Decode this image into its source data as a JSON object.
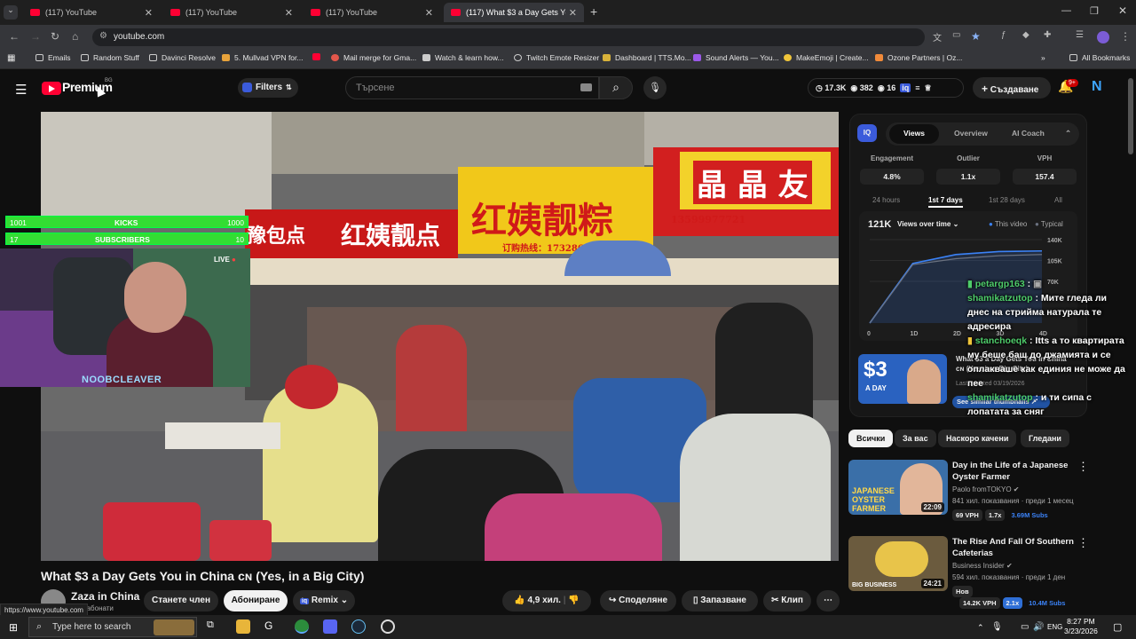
{
  "browser": {
    "tabs": [
      {
        "title": "(117) YouTube"
      },
      {
        "title": "(117) YouTube"
      },
      {
        "title": "(117) YouTube"
      },
      {
        "title": "(117) What $3 a Day Gets You in China"
      }
    ],
    "url": "youtube.com",
    "bookmarks": [
      "Emails",
      "Random Stuff",
      "Davinci Resolve",
      "5. Mullvad VPN for...",
      "Mail merge for Gma...",
      "Watch & learn how...",
      "Twitch Emote Resizer",
      "Dashboard | TTS.Mo...",
      "Sound Alerts — You...",
      "MakeEmoji | Create...",
      "Ozone Partners | Oz..."
    ],
    "all_bookmarks": "All Bookmarks",
    "status_url": "https://www.youtube.com"
  },
  "header": {
    "logo_text": "Premium",
    "logo_region": "BG",
    "filters_label": "Filters",
    "search_placeholder": "Търсене",
    "stats": {
      "views": "17.3K",
      "watching": "382",
      "count": "16"
    },
    "create_label": "Създаване",
    "notifications": "9+",
    "avatar_letter": "N"
  },
  "overlay": {
    "kicks_left": "1001",
    "kicks_label": "KICKS",
    "kicks_right": "1000",
    "subs_left": "17",
    "subs_label": "SUBSCRIBERS",
    "subs_right": "10",
    "kicks_progress": 1.0,
    "subs_progress": 1.0,
    "live_label": "LIVE",
    "streamer_name": "NOOBCLEAVER"
  },
  "video": {
    "signs": [
      "红姨靓粽",
      "晶 晶 友",
      "红姨靓点",
      "豫包点"
    ],
    "sign_phone": "订购热线：17328617438",
    "sign_phone2": "13599977721",
    "title": "What $3 a Day Gets You in China ᴄɴ (Yes, in a Big City)",
    "channel": "Zaza in China",
    "subscribers": "хил. абонати",
    "join_label": "Станете член",
    "subscribe_label": "Абониране",
    "remix_label": "Remix",
    "likes": "4,9 хил.",
    "share_label": "Споделяне",
    "save_label": "Запазване",
    "clip_label": "Клип"
  },
  "panel": {
    "tabs": [
      "Views",
      "Overview",
      "AI Coach"
    ],
    "metrics": [
      {
        "label": "Engagement",
        "value": "4.8%"
      },
      {
        "label": "Outlier",
        "value": "1.1x"
      },
      {
        "label": "VPH",
        "value": "157.4"
      }
    ],
    "ranges": [
      "24 hours",
      "1st 7 days",
      "1st 28 days",
      "All"
    ],
    "total_views": "121K",
    "chart_mode": "Views over time",
    "legend_this": "This video",
    "legend_typical": "Typical",
    "thumb_price": "$3",
    "thumb_sub": "A DAY",
    "thumb_title": "What $3 a Day Gets You in China ᴄɴ (Yes, in a Big City)",
    "last_updated": "Last updated 03/19/2026",
    "similar_label": "See similar thumbnails"
  },
  "chart_data": {
    "type": "line",
    "x": [
      "0",
      "1D",
      "2D",
      "3D",
      "4D"
    ],
    "series": [
      {
        "name": "This video",
        "values": [
          0,
          100,
          115,
          120,
          121
        ]
      },
      {
        "name": "Typical",
        "values": [
          0,
          98,
          108,
          113,
          115
        ]
      }
    ],
    "ytick_labels": [
      "140K",
      "105K",
      "70K"
    ],
    "ylim": [
      0,
      140
    ],
    "colors": {
      "this": "#3b82f6",
      "typical": "#6b7280"
    }
  },
  "chat": [
    {
      "user": "petargp163",
      "msg": ""
    },
    {
      "user": "shamikatzutop",
      "msg": "Мите гледа ли днес на стрийма натурала те адресира"
    },
    {
      "user": "stanchoeqk",
      "msg": "Itts а то квартирата му беше баш до джамията и се оплакваше как единия не може да пее"
    },
    {
      "user": "shamikatzutop",
      "msg": "и ти сипа с лопатата за сняг"
    }
  ],
  "chips": [
    "Всички",
    "За вас",
    "Наскоро качени",
    "Гледани"
  ],
  "related": [
    {
      "title": "Day in the Life of a Japanese Oyster Farmer",
      "channel": "Paolo fromTOKYO",
      "meta": "841 хил. показвания · преди 1 месец",
      "duration": "22:09",
      "thumb_text": "JAPANESE OYSTER FARMER",
      "badges": [
        "69 VPH",
        "1.7x",
        "3.69M Subs"
      ]
    },
    {
      "title": "The Rise And Fall Of Southern Cafeterias",
      "channel": "Business Insider",
      "meta": "594 хил. показвания · преди 1 ден",
      "tag": "Нов",
      "duration": "24:21",
      "thumb_text": "BIG BUSINESS",
      "badges": [
        "14.2K VPH",
        "2.1x",
        "10.4M Subs"
      ]
    }
  ],
  "taskbar": {
    "search_placeholder": "Type here to search",
    "lang": "ENG",
    "time": "8:27 PM",
    "date": "3/23/2026"
  }
}
